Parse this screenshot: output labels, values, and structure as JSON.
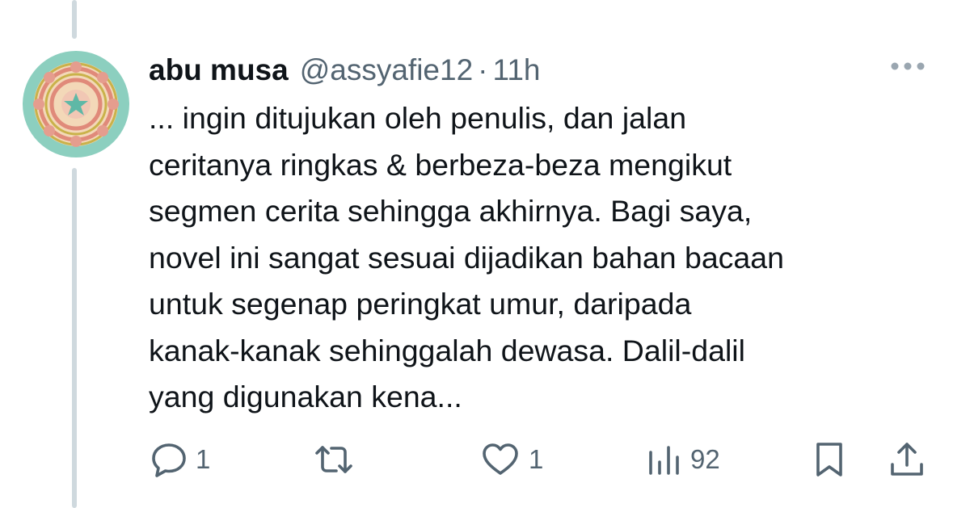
{
  "tweet": {
    "author_name": "abu musa",
    "handle": "@assyafie12",
    "separator": "·",
    "time": "11h",
    "lines": [
      "... ingin ditujukan oleh penulis, dan jalan",
      "ceritanya ringkas & berbeza-beza mengikut",
      "segmen cerita sehingga akhirnya. Bagi saya,",
      "novel ini sangat sesuai dijadikan bahan bacaan",
      "untuk segenap peringkat umur, daripada",
      "kanak-kanak sehinggalah dewasa. Dalil-dalil",
      "yang digunakan kena..."
    ]
  },
  "actions": {
    "reply_count": "1",
    "like_count": "1",
    "views_count": "92"
  },
  "icons": {
    "more": "more-horizontal-icon",
    "reply": "reply-icon",
    "retweet": "retweet-icon",
    "like": "heart-icon",
    "views": "views-chart-icon",
    "bookmark": "bookmark-icon",
    "share": "share-icon"
  },
  "colors": {
    "text_primary": "#0f1419",
    "text_secondary": "#536471",
    "thread_line": "#cfd9de",
    "avatar_background": "#8ccfbf"
  }
}
